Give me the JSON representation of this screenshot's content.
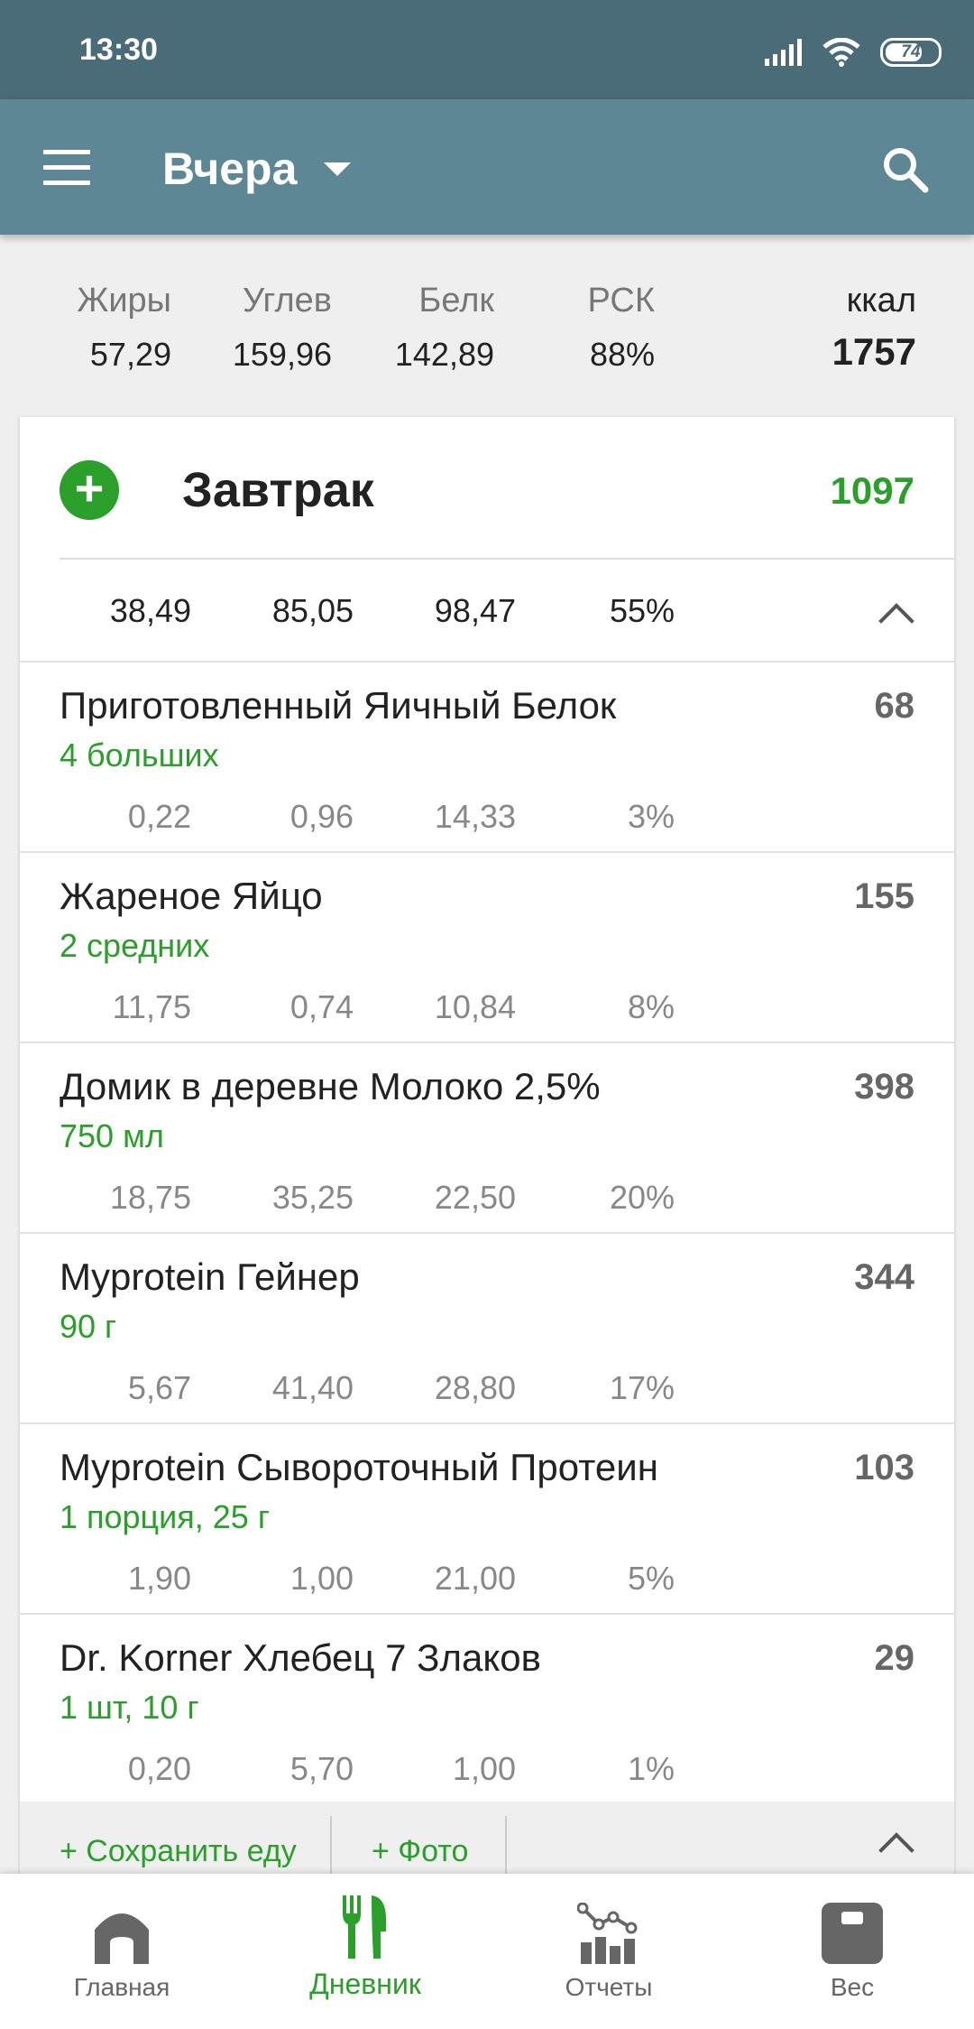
{
  "status_bar": {
    "time": "13:30",
    "battery": "74",
    "battery_level": 0.74
  },
  "app_bar": {
    "title": "Вчера"
  },
  "summary": {
    "fat_label": "Жиры",
    "fat_value": "57,29",
    "carbs_label": "Углев",
    "carbs_value": "159,96",
    "protein_label": "Белк",
    "protein_value": "142,89",
    "rdi_label": "РСК",
    "rdi_value": "88%",
    "kcal_label": "ккал",
    "kcal_value": "1757"
  },
  "meal": {
    "title": "Завтрак",
    "kcal": "1097",
    "totals": {
      "fat": "38,49",
      "carbs": "85,05",
      "protein": "98,47",
      "rdi": "55%"
    },
    "items": [
      {
        "name": "Приготовленный Яичный Белок",
        "serving": "4 больших",
        "kcal": "68",
        "fat": "0,22",
        "carbs": "0,96",
        "protein": "14,33",
        "rdi": "3%"
      },
      {
        "name": "Жареное Яйцо",
        "serving": "2 средних",
        "kcal": "155",
        "fat": "11,75",
        "carbs": "0,74",
        "protein": "10,84",
        "rdi": "8%"
      },
      {
        "name": "Домик в деревне Молоко 2,5%",
        "serving": "750 мл",
        "kcal": "398",
        "fat": "18,75",
        "carbs": "35,25",
        "protein": "22,50",
        "rdi": "20%"
      },
      {
        "name": "Myprotein Гейнер",
        "serving": "90 г",
        "kcal": "344",
        "fat": "5,67",
        "carbs": "41,40",
        "protein": "28,80",
        "rdi": "17%"
      },
      {
        "name": "Myprotein Сывороточный Протеин",
        "serving": "1 порция, 25 г",
        "kcal": "103",
        "fat": "1,90",
        "carbs": "1,00",
        "protein": "21,00",
        "rdi": "5%"
      },
      {
        "name": "Dr. Korner Хлебец 7 Злаков",
        "serving": "1 шт, 10 г",
        "kcal": "29",
        "fat": "0,20",
        "carbs": "5,70",
        "protein": "1,00",
        "rdi": "1%"
      }
    ],
    "footer": {
      "save_label": "+ Сохранить еду",
      "photo_label": "+ Фото"
    }
  },
  "bottom_nav": [
    {
      "label": "Главная",
      "icon": "home-icon"
    },
    {
      "label": "Дневник",
      "icon": "fork-knife-icon",
      "active": true
    },
    {
      "label": "Отчеты",
      "icon": "chart-icon"
    },
    {
      "label": "Вес",
      "icon": "scale-icon"
    }
  ],
  "colors": {
    "accent_green": "#2aa02a",
    "appbar": "#5e8795",
    "statusbar": "#4a6b78"
  }
}
